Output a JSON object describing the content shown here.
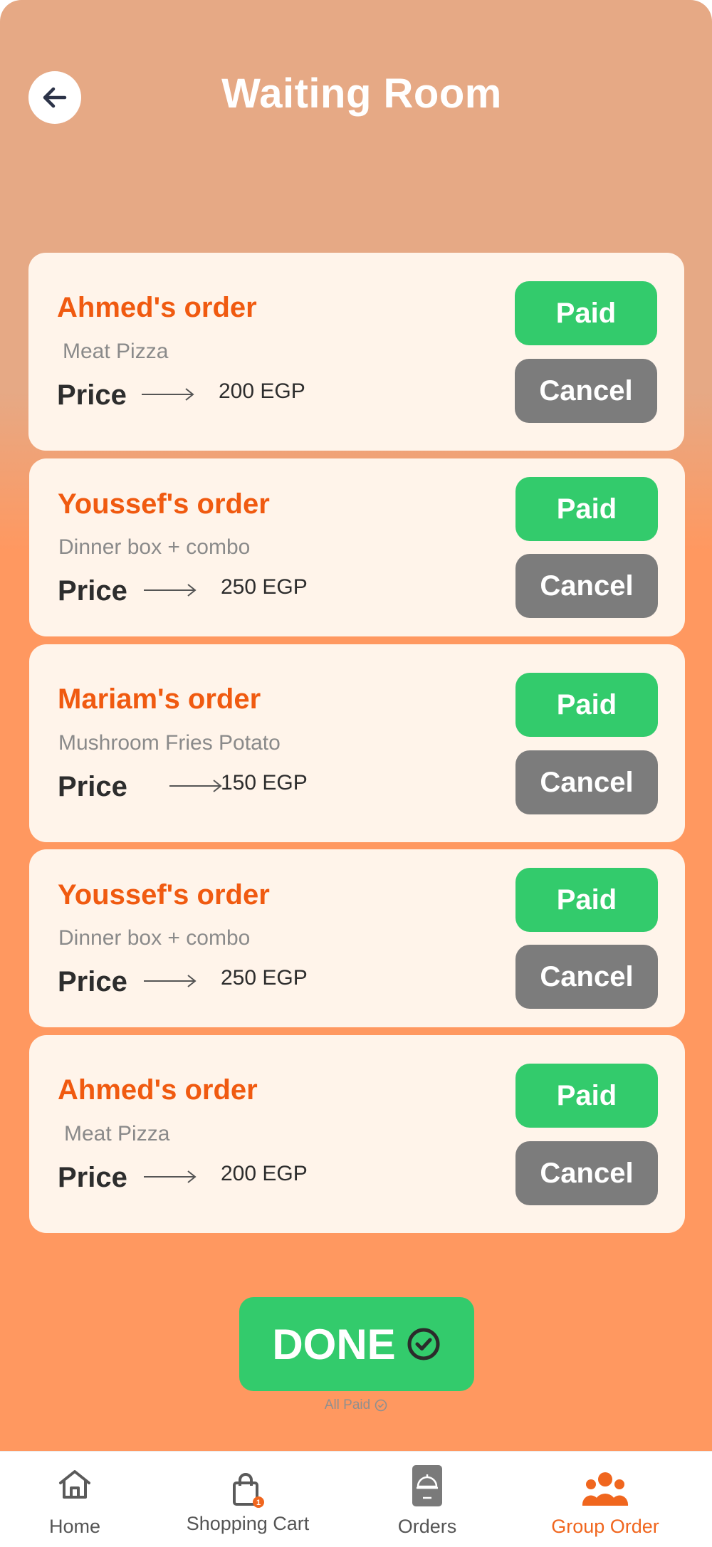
{
  "header": {
    "title": "Waiting Room"
  },
  "orders": [
    {
      "name": "Ahmed's order",
      "item": "Meat Pizza",
      "price_label": "Price",
      "amount": "200 EGP",
      "paid_label": "Paid",
      "cancel_label": "Cancel"
    },
    {
      "name": "Youssef's order",
      "item": "Dinner box  + combo",
      "price_label": "Price",
      "amount": "250 EGP",
      "paid_label": "Paid",
      "cancel_label": "Cancel"
    },
    {
      "name": "Mariam's order",
      "item": "Mushroom Fries Potato",
      "price_label": "Price",
      "amount": "150 EGP",
      "paid_label": "Paid",
      "cancel_label": "Cancel"
    },
    {
      "name": "Youssef's order",
      "item": "Dinner box  + combo",
      "price_label": "Price",
      "amount": "250 EGP",
      "paid_label": "Paid",
      "cancel_label": "Cancel"
    },
    {
      "name": "Ahmed's order",
      "item": "Meat Pizza",
      "price_label": "Price",
      "amount": "200 EGP",
      "paid_label": "Paid",
      "cancel_label": "Cancel"
    }
  ],
  "done": {
    "label": "DONE",
    "status": "All Paid"
  },
  "nav": {
    "items": [
      {
        "label": "Home",
        "icon": "home-icon"
      },
      {
        "label": "Shopping Cart",
        "icon": "shopping-bag-icon",
        "badge": "1"
      },
      {
        "label": "Orders",
        "icon": "cloche-icon"
      },
      {
        "label": "Group Order",
        "icon": "group-icon",
        "active": true
      }
    ]
  },
  "colors": {
    "accent": "#f05a10",
    "paid": "#33cb6c",
    "cancel": "#7c7c7c",
    "card": "#fff4ea",
    "bg_top": "#e6a985",
    "bg_bottom": "#ff9860"
  }
}
